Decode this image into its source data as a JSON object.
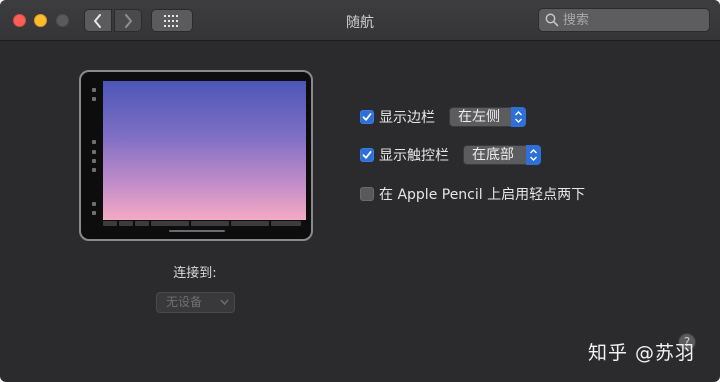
{
  "window": {
    "title": "随航"
  },
  "toolbar": {
    "back_icon": "chevron-left-icon",
    "forward_icon": "chevron-right-icon",
    "grid_icon": "grid-icon"
  },
  "search": {
    "placeholder": "搜索",
    "value": ""
  },
  "connect": {
    "label": "连接到:",
    "device_value": "无设备"
  },
  "options": {
    "sidebar": {
      "label": "显示边栏",
      "checked": true,
      "position_value": "在左侧"
    },
    "touchbar": {
      "label": "显示触控栏",
      "checked": true,
      "position_value": "在底部"
    },
    "pencil": {
      "label": "在 Apple Pencil 上启用轻点两下",
      "checked": false
    }
  },
  "watermark": {
    "text": "知乎 @苏羽"
  },
  "help": {
    "label": "?"
  },
  "colors": {
    "accent": "#2f6fd8",
    "close": "#fc5f57",
    "minimize": "#fdbc2e",
    "screen_top": "#4c56b8",
    "screen_bottom": "#f4aac2"
  }
}
